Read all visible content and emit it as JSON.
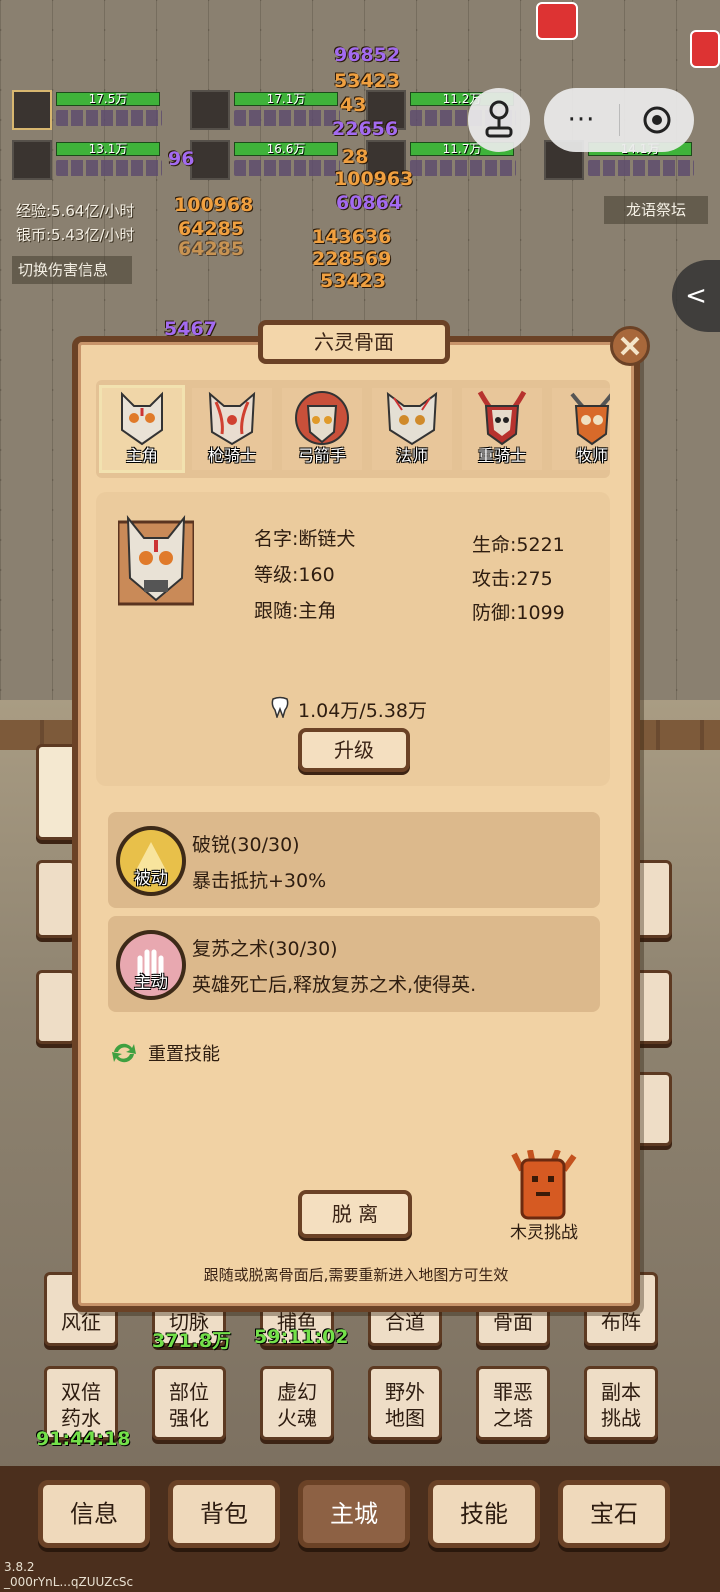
{
  "heroes": [
    {
      "hp": "17.5万"
    },
    {
      "hp": "17.1万"
    },
    {
      "hp": "11.2万"
    },
    {
      "hp": "13.1万"
    },
    {
      "hp": "16.6万"
    },
    {
      "hp": "11.7万"
    },
    {
      "hp": "14.1万"
    }
  ],
  "damage_numbers": [
    "96852",
    "53423",
    "43",
    "22656",
    "96",
    "28",
    "100963",
    "100968",
    "60864",
    "64285",
    "64285",
    "143636",
    "228569",
    "53423",
    "5467"
  ],
  "stats": {
    "exp": "经验:5.64亿/小时",
    "silver": "银币:5.43亿/小时",
    "toggle": "切换伤害信息",
    "map_name": "龙语祭坛"
  },
  "capsule": {
    "more": "···",
    "side_tab": "<"
  },
  "panel": {
    "title": "六灵骨面",
    "masks": [
      {
        "name": "主角",
        "color": "#e9e2d6"
      },
      {
        "name": "枪骑士",
        "color": "#e9ddd0"
      },
      {
        "name": "弓箭手",
        "color": "#c9503a"
      },
      {
        "name": "法师",
        "color": "#e4dfd4"
      },
      {
        "name": "重骑士",
        "color": "#b7322e"
      },
      {
        "name": "牧师",
        "color": "#d86a2a"
      }
    ],
    "info": {
      "name": "名字:断链犬",
      "level": "等级:160",
      "follow": "跟随:主角",
      "hp": "生命:5221",
      "atk": "攻击:275",
      "def": "防御:1099"
    },
    "exp_text": "1.04万/5.38万",
    "upgrade": "升级",
    "skills": [
      {
        "name": "破锐(30/30)",
        "desc": "暴击抵抗+30%",
        "tag": "被动",
        "icon": "shield-burst-icon"
      },
      {
        "name": "复苏之术(30/30)",
        "desc": "英雄死亡后,释放复苏之术,使得英.",
        "tag": "主动",
        "icon": "resurrect-hand-icon"
      }
    ],
    "reset": "重置技能",
    "leave": "脱 离",
    "tree_challenge": "木灵挑战",
    "notice": "跟随或脱离骨面后,需要重新进入地图方可生效"
  },
  "tiles_row1": [
    {
      "label": "风征"
    },
    {
      "label": "切脉",
      "sub": "371.8万"
    },
    {
      "label": "捕鱼",
      "sub": "59:11:02"
    },
    {
      "label": "合道"
    },
    {
      "label": "骨面"
    },
    {
      "label": "布阵"
    }
  ],
  "tiles_row2": [
    {
      "line1": "双倍",
      "line2": "药水",
      "sub": "91:44:18"
    },
    {
      "line1": "部位",
      "line2": "强化"
    },
    {
      "line1": "虚幻",
      "line2": "火魂"
    },
    {
      "line1": "野外",
      "line2": "地图"
    },
    {
      "line1": "罪恶",
      "line2": "之塔"
    },
    {
      "line1": "副本",
      "line2": "挑战"
    }
  ],
  "nav": [
    "信息",
    "背包",
    "主城",
    "技能",
    "宝石"
  ],
  "nav_active": "主城",
  "version": {
    "line1": "3.8.2",
    "line2": "_000rYnL...qZUUZcSc"
  }
}
